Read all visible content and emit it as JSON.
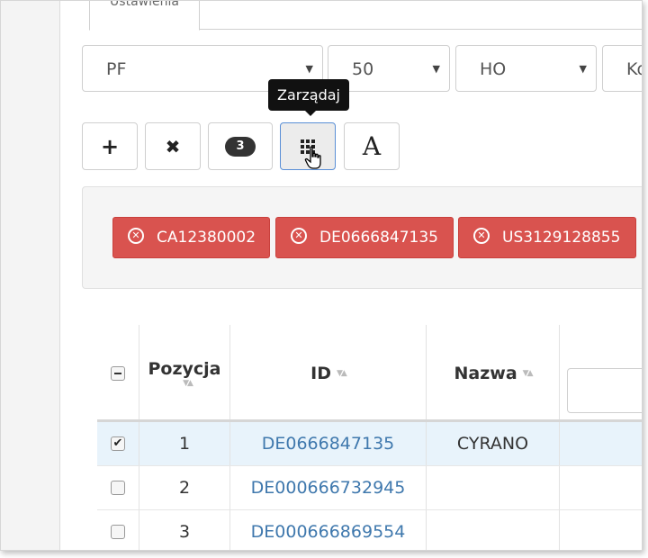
{
  "tabs": {
    "active_label": "Ustawienia"
  },
  "selects": [
    {
      "value": "PF"
    },
    {
      "value": "50"
    },
    {
      "value": "HO"
    },
    {
      "value": "Ko"
    }
  ],
  "tooltip": {
    "text": "Zarządaj"
  },
  "toolbar": {
    "add_icon": "+",
    "remove_icon": "✖",
    "count_badge": "3",
    "font_label": "A"
  },
  "chips": [
    {
      "label": "CA12380002"
    },
    {
      "label": "DE0666847135"
    },
    {
      "label": "US3129128855"
    }
  ],
  "table": {
    "headers": {
      "position": "Pozycja",
      "id": "ID",
      "name": "Nazwa"
    },
    "rows": [
      {
        "position": "1",
        "id": "DE0666847135",
        "name": "CYRANO",
        "checked": true
      },
      {
        "position": "2",
        "id": "DE000666732945",
        "name": "",
        "checked": false
      },
      {
        "position": "3",
        "id": "DE000666869554",
        "name": "",
        "checked": false
      }
    ]
  },
  "colors": {
    "danger": "#d9534f",
    "link": "#3f78ad",
    "tooltip_bg": "#111111",
    "selected_row": "#e8f3fb"
  }
}
